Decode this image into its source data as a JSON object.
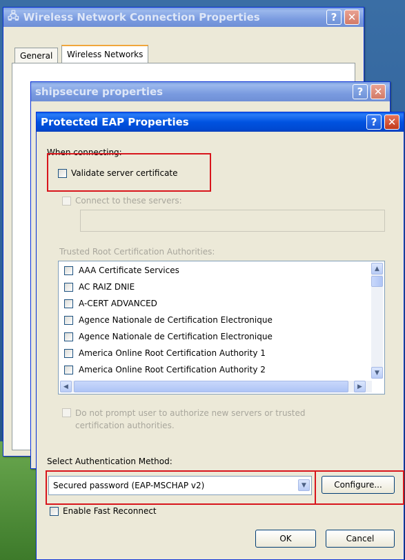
{
  "back_window": {
    "title": "Wireless Network Connection Properties",
    "tabs": [
      "General",
      "Wireless Networks"
    ]
  },
  "middle_window": {
    "title": "shipsecure properties"
  },
  "peap_dialog": {
    "title": "Protected EAP Properties",
    "when_connecting": "When connecting:",
    "validate_server_cert": "Validate server certificate",
    "connect_to_servers": "Connect to these servers:",
    "servers_value": "",
    "trusted_root_label": "Trusted Root Certification Authorities:",
    "cert_list": [
      "AAA Certificate Services",
      "AC RAIZ DNIE",
      "A-CERT ADVANCED",
      "Agence Nationale de Certification Electronique",
      "Agence Nationale de Certification Electronique",
      "America Online Root Certification Authority 1",
      "America Online Root Certification Authority 2"
    ],
    "do_not_prompt_line1": "Do not prompt user to authorize new servers or trusted",
    "do_not_prompt_line2": "certification authorities.",
    "auth_method_label": "Select Authentication Method:",
    "auth_method_value": "Secured password (EAP-MSCHAP v2)",
    "configure_label": "Configure...",
    "fast_reconnect": "Enable Fast Reconnect",
    "ok_label": "OK",
    "cancel_label": "Cancel"
  },
  "icons": {
    "help": "?",
    "close": "✕"
  },
  "colors": {
    "highlight_box": "#d8141b",
    "titlebar_active": "#0053e0"
  }
}
